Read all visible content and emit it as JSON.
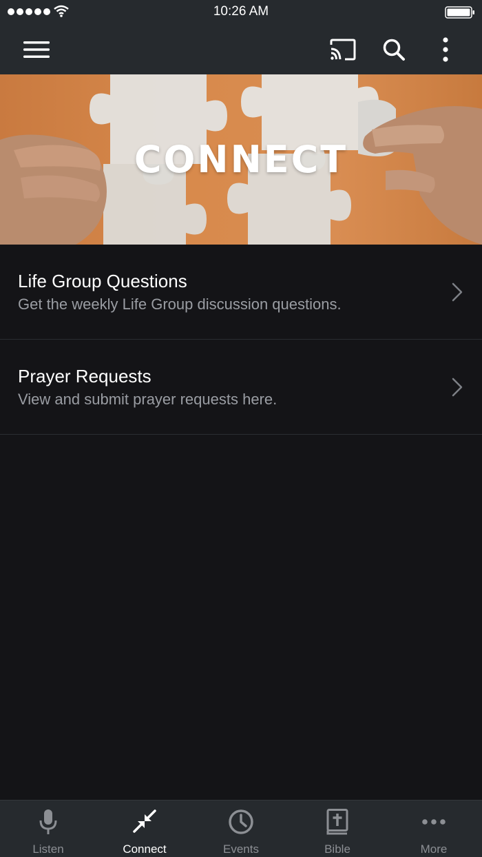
{
  "status_bar": {
    "time": "10:26 AM"
  },
  "app_bar": {
    "icons": [
      "hamburger-menu-icon",
      "cast-icon",
      "search-icon",
      "more-vert-icon"
    ]
  },
  "hero": {
    "title": "CONNECT",
    "accent_color": "#d88a4c"
  },
  "list": [
    {
      "title": "Life Group Questions",
      "subtitle": "Get the weekly Life Group discussion questions."
    },
    {
      "title": "Prayer Requests",
      "subtitle": "View and submit prayer requests here."
    }
  ],
  "tabs": [
    {
      "label": "Listen",
      "icon": "microphone-icon",
      "active": false
    },
    {
      "label": "Connect",
      "icon": "connect-arrows-icon",
      "active": true
    },
    {
      "label": "Events",
      "icon": "clock-icon",
      "active": false
    },
    {
      "label": "Bible",
      "icon": "bible-icon",
      "active": false
    },
    {
      "label": "More",
      "icon": "more-dots-icon",
      "active": false
    }
  ],
  "colors": {
    "background": "#141417",
    "bar": "#262a2e",
    "inactive": "#8c8f94",
    "active": "#ffffff"
  }
}
